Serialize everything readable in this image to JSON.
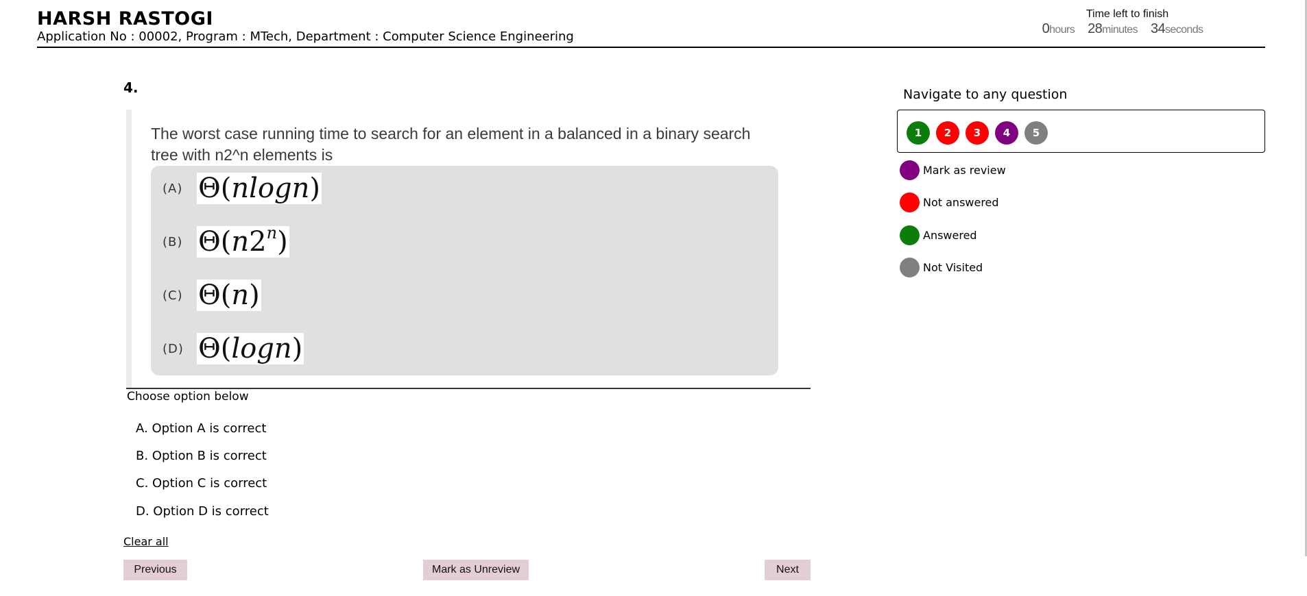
{
  "candidate": {
    "name": "HARSH RASTOGI",
    "info": "Application No : 00002, Program : MTech, Department : Computer Science Engineering"
  },
  "timer": {
    "title": "Time left to finish",
    "hours": "0",
    "hours_unit": "hours",
    "minutes": "28",
    "minutes_unit": "minutes",
    "seconds": "34",
    "seconds_unit": "seconds"
  },
  "question": {
    "number": "4.",
    "text": "The worst case running time to search for an element in a balanced in a binary search tree with n2^n elements is",
    "options": [
      {
        "letter": "(A)",
        "func": "Θ(",
        "var": "nlogn",
        "close": ")"
      },
      {
        "letter": "(B)",
        "func": "Θ(",
        "var": "n",
        "mid": "2",
        "sup": "n",
        "close": ")"
      },
      {
        "letter": "(C)",
        "func": "Θ(",
        "var": "n",
        "close": ")"
      },
      {
        "letter": "(D)",
        "func": "Θ(",
        "var": "logn",
        "close": ")"
      }
    ]
  },
  "answer": {
    "choose_label": "Choose option below",
    "choices": [
      "A. Option A is correct",
      "B. Option B is correct",
      "C. Option C is correct",
      "D. Option D is correct"
    ],
    "clear_all": "Clear all"
  },
  "buttons": {
    "previous": "Previous",
    "mark": "Mark as Unreview",
    "next": "Next"
  },
  "navigator": {
    "title": "Navigate to any question",
    "questions": [
      {
        "label": "1",
        "status": "answered",
        "color": "#0a7d0a"
      },
      {
        "label": "2",
        "status": "not-answered",
        "color": "#ff0000"
      },
      {
        "label": "3",
        "status": "not-answered",
        "color": "#ff0000"
      },
      {
        "label": "4",
        "status": "mark-as-review",
        "color": "#800080"
      },
      {
        "label": "5",
        "status": "not-visited",
        "color": "#808080"
      }
    ],
    "legend": [
      {
        "label": "Mark as review",
        "color": "#800080"
      },
      {
        "label": "Not answered",
        "color": "#ff0000"
      },
      {
        "label": "Answered",
        "color": "#0a7d0a"
      },
      {
        "label": "Not Visited",
        "color": "#808080"
      }
    ]
  }
}
